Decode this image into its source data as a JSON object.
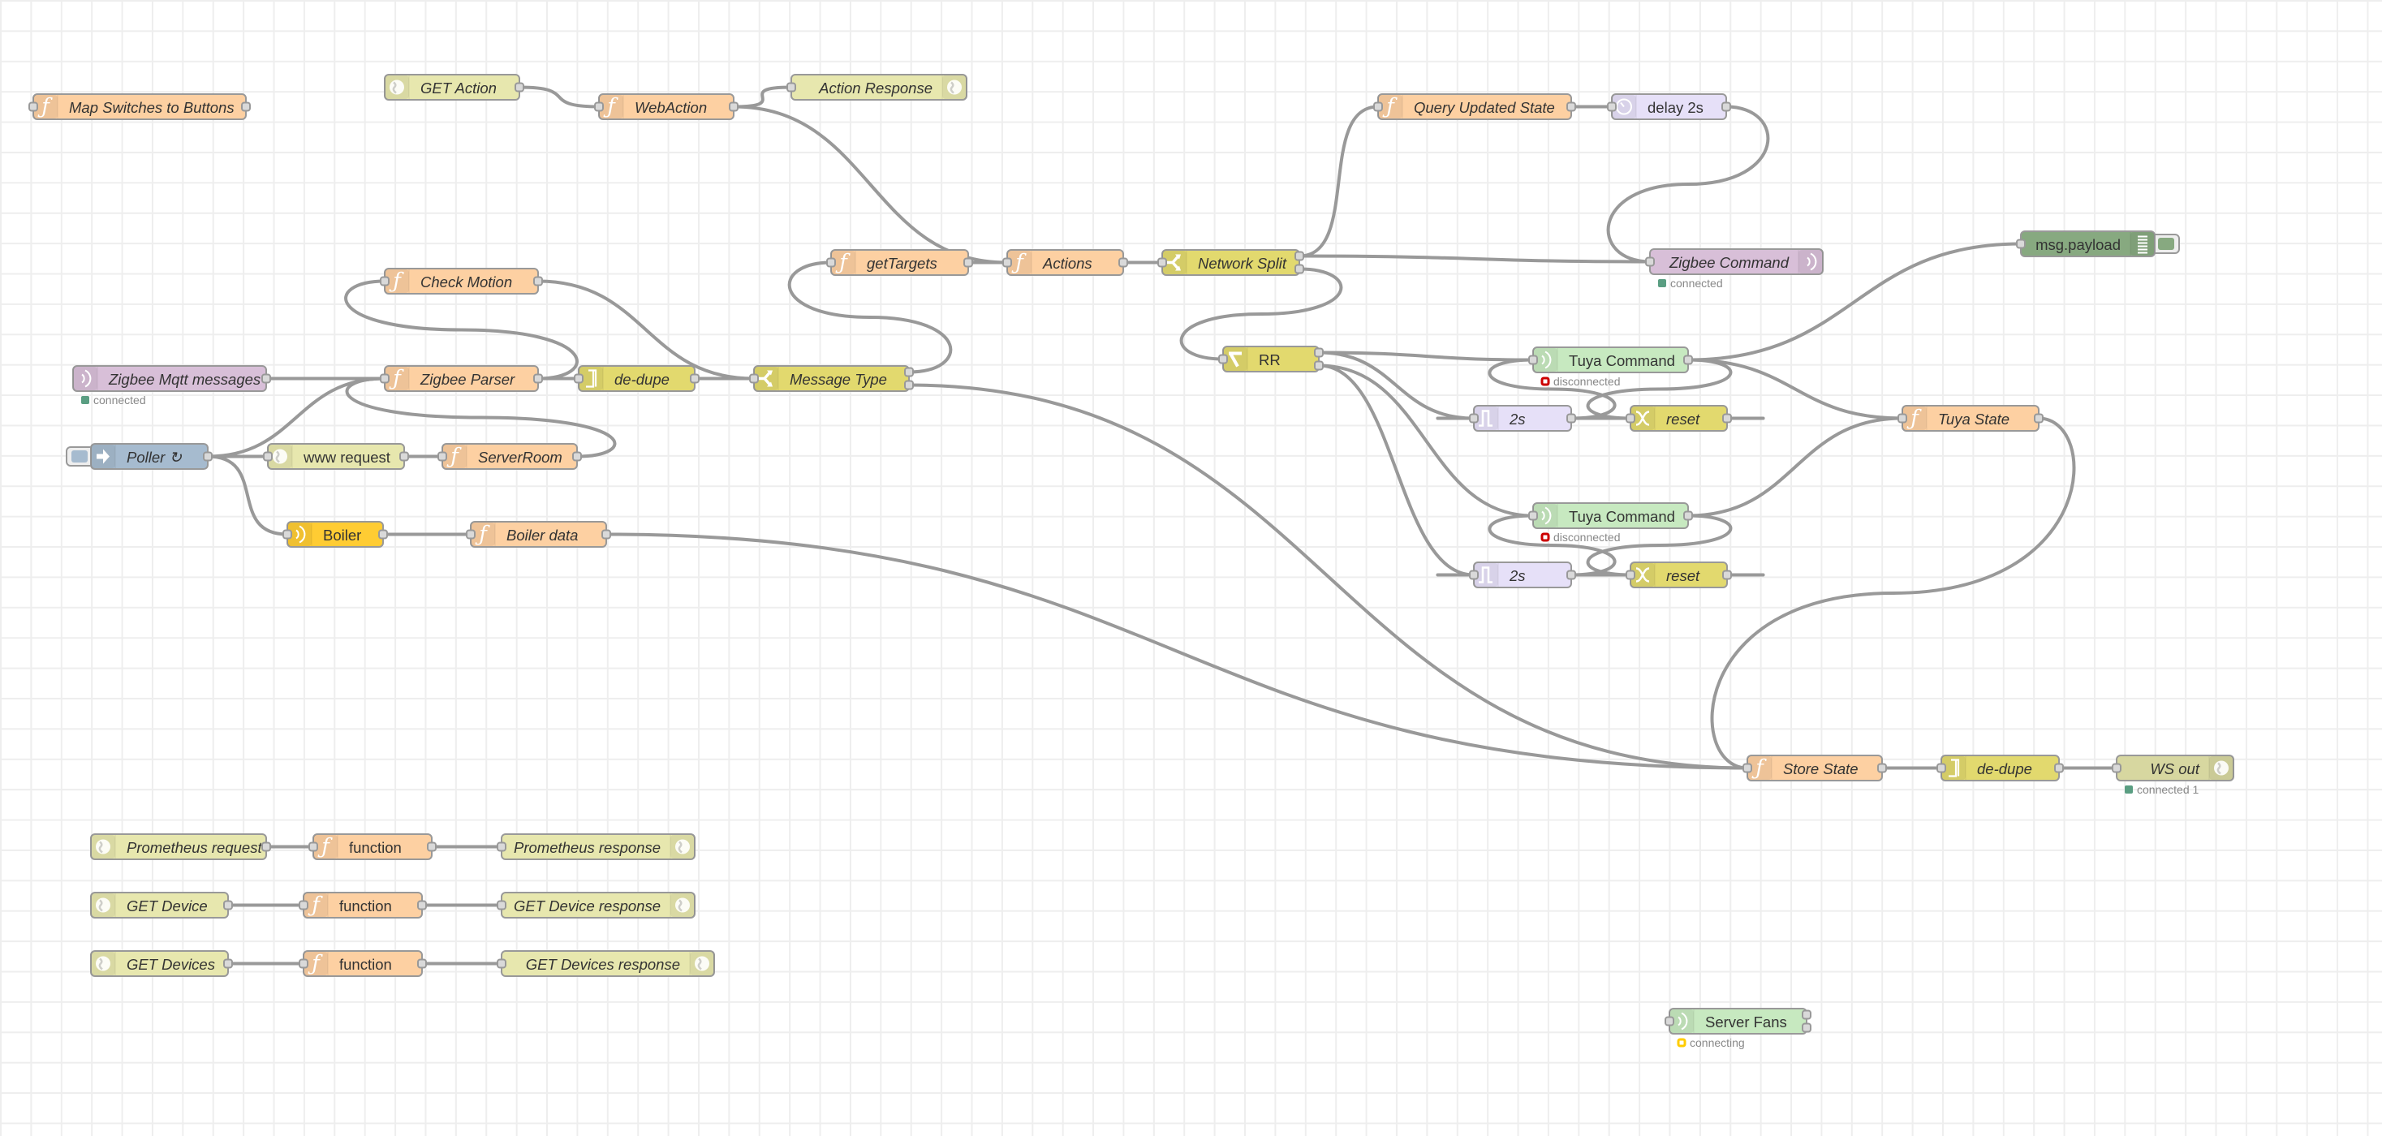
{
  "app": "Node-RED flow editor",
  "colors": {
    "function": "#fdd0a2",
    "http": "#e7e7ae",
    "websocket": "#d7d7a0",
    "mqtt": "#d8bfd8",
    "delay": "#e6e0f8",
    "switch": "#e2d96e",
    "inject": "#a6bbcf",
    "debug": "#87a980",
    "tuya": "#c7e9c0",
    "serial": "#ffcc33",
    "wire": "#999999",
    "status_green": "#5a9",
    "status_red": "#c00",
    "status_yellow": "#ffcc00",
    "selected": "#ff7f0e"
  },
  "nodes": [
    {
      "id": "map-switches",
      "label": "Map Switches to Buttons",
      "type": "function",
      "icon": "function-icon",
      "italic": true
    },
    {
      "id": "get-action",
      "label": "GET Action",
      "type": "http-in",
      "icon": "globe-icon",
      "italic": true
    },
    {
      "id": "webaction",
      "label": "WebAction",
      "type": "function",
      "icon": "function-icon",
      "italic": true
    },
    {
      "id": "action-response",
      "label": "Action Response",
      "type": "http-response",
      "icon": "globe-icon",
      "italic": true
    },
    {
      "id": "query-updated-state",
      "label": "Query Updated State",
      "type": "function",
      "icon": "function-icon",
      "italic": true
    },
    {
      "id": "delay-2s",
      "label": "delay 2s",
      "type": "delay",
      "icon": "timer-icon",
      "italic": false
    },
    {
      "id": "zigbee-command",
      "label": "Zigbee Command",
      "type": "mqtt-out",
      "icon": "radio-waves-icon",
      "italic": true,
      "status": {
        "text": "connected",
        "color": "green",
        "shape": "dot"
      }
    },
    {
      "id": "msg-payload",
      "label": "msg.payload",
      "type": "debug",
      "icon": "list-icon",
      "italic": false
    },
    {
      "id": "gettargets",
      "label": "getTargets",
      "type": "function",
      "icon": "function-icon",
      "italic": true
    },
    {
      "id": "actions",
      "label": "Actions",
      "type": "function",
      "icon": "function-icon",
      "italic": true
    },
    {
      "id": "network-split",
      "label": "Network Split",
      "type": "switch",
      "icon": "split-icon",
      "italic": true
    },
    {
      "id": "check-motion",
      "label": "Check Motion",
      "type": "function",
      "icon": "function-icon",
      "italic": true
    },
    {
      "id": "zigbee-mqtt",
      "label": "Zigbee Mqtt messages",
      "type": "mqtt-in",
      "icon": "radio-waves-icon",
      "italic": true,
      "status": {
        "text": "connected",
        "color": "green",
        "shape": "dot"
      }
    },
    {
      "id": "zigbee-parser",
      "label": "Zigbee Parser",
      "type": "function",
      "icon": "function-icon",
      "italic": true
    },
    {
      "id": "dedupe-1",
      "label": "de-dupe",
      "type": "rbe",
      "icon": "rbe-icon",
      "italic": true
    },
    {
      "id": "message-type",
      "label": "Message Type",
      "type": "switch",
      "icon": "split-icon",
      "italic": true
    },
    {
      "id": "rr",
      "label": "RR",
      "type": "switch",
      "icon": "route-icon",
      "italic": false,
      "selected": true
    },
    {
      "id": "poller",
      "label": "Poller ↻",
      "type": "inject",
      "icon": "arrow-right-icon",
      "italic": true
    },
    {
      "id": "www-request",
      "label": "www request",
      "type": "http-request",
      "icon": "globe-icon",
      "italic": false
    },
    {
      "id": "serverroom",
      "label": "ServerRoom",
      "type": "function",
      "icon": "function-icon",
      "italic": true
    },
    {
      "id": "boiler",
      "label": "Boiler",
      "type": "serial",
      "icon": "radio-waves-icon",
      "italic": false
    },
    {
      "id": "boiler-data",
      "label": "Boiler data",
      "type": "function",
      "icon": "function-icon",
      "italic": true
    },
    {
      "id": "tuya-command-1",
      "label": "Tuya Command",
      "type": "tuya",
      "icon": "radio-waves-icon",
      "italic": false,
      "status": {
        "text": "disconnected",
        "color": "red",
        "shape": "ring"
      }
    },
    {
      "id": "trigger-2s-1",
      "label": "2s",
      "type": "trigger",
      "icon": "trigger-icon",
      "italic": true
    },
    {
      "id": "reset-1",
      "label": "reset",
      "type": "change",
      "icon": "shuffle-icon",
      "italic": true
    },
    {
      "id": "tuya-state",
      "label": "Tuya State",
      "type": "function",
      "icon": "function-icon",
      "italic": true
    },
    {
      "id": "tuya-command-2",
      "label": "Tuya Command",
      "type": "tuya",
      "icon": "radio-waves-icon",
      "italic": false,
      "status": {
        "text": "disconnected",
        "color": "red",
        "shape": "ring"
      }
    },
    {
      "id": "trigger-2s-2",
      "label": "2s",
      "type": "trigger",
      "icon": "trigger-icon",
      "italic": true
    },
    {
      "id": "reset-2",
      "label": "reset",
      "type": "change",
      "icon": "shuffle-icon",
      "italic": true
    },
    {
      "id": "store-state",
      "label": "Store State",
      "type": "function",
      "icon": "function-icon",
      "italic": true
    },
    {
      "id": "dedupe-2",
      "label": "de-dupe",
      "type": "rbe",
      "icon": "rbe-icon",
      "italic": true
    },
    {
      "id": "ws-out",
      "label": "WS out",
      "type": "websocket-out",
      "icon": "globe-icon",
      "italic": true,
      "status": {
        "text": "connected 1",
        "color": "green",
        "shape": "dot"
      }
    },
    {
      "id": "prometheus-request",
      "label": "Prometheus request",
      "type": "http-in",
      "icon": "globe-icon",
      "italic": true
    },
    {
      "id": "function-1",
      "label": "function",
      "type": "function",
      "icon": "function-icon",
      "italic": false
    },
    {
      "id": "prometheus-response",
      "label": "Prometheus response",
      "type": "http-response",
      "icon": "globe-icon",
      "italic": true
    },
    {
      "id": "get-device",
      "label": "GET Device",
      "type": "http-in",
      "icon": "globe-icon",
      "italic": true
    },
    {
      "id": "function-2",
      "label": "function",
      "type": "function",
      "icon": "function-icon",
      "italic": false
    },
    {
      "id": "get-device-response",
      "label": "GET Device response",
      "type": "http-response",
      "icon": "globe-icon",
      "italic": true
    },
    {
      "id": "get-devices",
      "label": "GET Devices",
      "type": "http-in",
      "icon": "globe-icon",
      "italic": true
    },
    {
      "id": "function-3",
      "label": "function",
      "type": "function",
      "icon": "function-icon",
      "italic": false
    },
    {
      "id": "get-devices-response",
      "label": "GET Devices response",
      "type": "http-response",
      "icon": "globe-icon",
      "italic": true
    },
    {
      "id": "server-fans",
      "label": "Server Fans",
      "type": "tuya",
      "icon": "radio-waves-icon",
      "italic": false,
      "status": {
        "text": "connecting",
        "color": "yellow",
        "shape": "ring"
      }
    }
  ],
  "wires": [
    [
      "get-action",
      0,
      "webaction"
    ],
    [
      "webaction",
      0,
      "action-response"
    ],
    [
      "webaction",
      0,
      "actions"
    ],
    [
      "query-updated-state",
      0,
      "delay-2s"
    ],
    [
      "delay-2s",
      0,
      "zigbee-command"
    ],
    [
      "gettargets",
      0,
      "actions"
    ],
    [
      "actions",
      0,
      "network-split"
    ],
    [
      "network-split",
      0,
      "query-updated-state"
    ],
    [
      "network-split",
      0,
      "zigbee-command"
    ],
    [
      "network-split",
      1,
      "rr"
    ],
    [
      "zigbee-mqtt",
      0,
      "zigbee-parser"
    ],
    [
      "zigbee-parser",
      0,
      "dedupe-1"
    ],
    [
      "zigbee-parser",
      0,
      "check-motion"
    ],
    [
      "check-motion",
      0,
      "message-type"
    ],
    [
      "dedupe-1",
      0,
      "message-type"
    ],
    [
      "message-type",
      0,
      "gettargets"
    ],
    [
      "message-type",
      1,
      "store-state"
    ],
    [
      "poller",
      0,
      "www-request"
    ],
    [
      "poller",
      0,
      "zigbee-parser"
    ],
    [
      "poller",
      0,
      "boiler"
    ],
    [
      "www-request",
      0,
      "serverroom"
    ],
    [
      "serverroom",
      0,
      "zigbee-parser"
    ],
    [
      "boiler",
      0,
      "boiler-data"
    ],
    [
      "boiler-data",
      0,
      "store-state"
    ],
    [
      "rr",
      0,
      "tuya-command-1"
    ],
    [
      "rr",
      0,
      "trigger-2s-1"
    ],
    [
      "rr",
      1,
      "tuya-command-2"
    ],
    [
      "rr",
      1,
      "trigger-2s-2"
    ],
    [
      "tuya-command-1",
      0,
      "msg-payload"
    ],
    [
      "tuya-command-1",
      0,
      "tuya-state"
    ],
    [
      "tuya-command-1",
      0,
      "reset-1"
    ],
    [
      "trigger-2s-1",
      0,
      "tuya-command-1"
    ],
    [
      "reset-1",
      0,
      "trigger-2s-1"
    ],
    [
      "tuya-command-2",
      0,
      "tuya-state"
    ],
    [
      "tuya-command-2",
      0,
      "reset-2"
    ],
    [
      "trigger-2s-2",
      0,
      "tuya-command-2"
    ],
    [
      "reset-2",
      0,
      "trigger-2s-2"
    ],
    [
      "tuya-state",
      0,
      "store-state"
    ],
    [
      "store-state",
      0,
      "dedupe-2"
    ],
    [
      "dedupe-2",
      0,
      "ws-out"
    ],
    [
      "prometheus-request",
      0,
      "function-1"
    ],
    [
      "function-1",
      0,
      "prometheus-response"
    ],
    [
      "get-device",
      0,
      "function-2"
    ],
    [
      "function-2",
      0,
      "get-device-response"
    ],
    [
      "get-devices",
      0,
      "function-3"
    ],
    [
      "function-3",
      0,
      "get-devices-response"
    ]
  ]
}
